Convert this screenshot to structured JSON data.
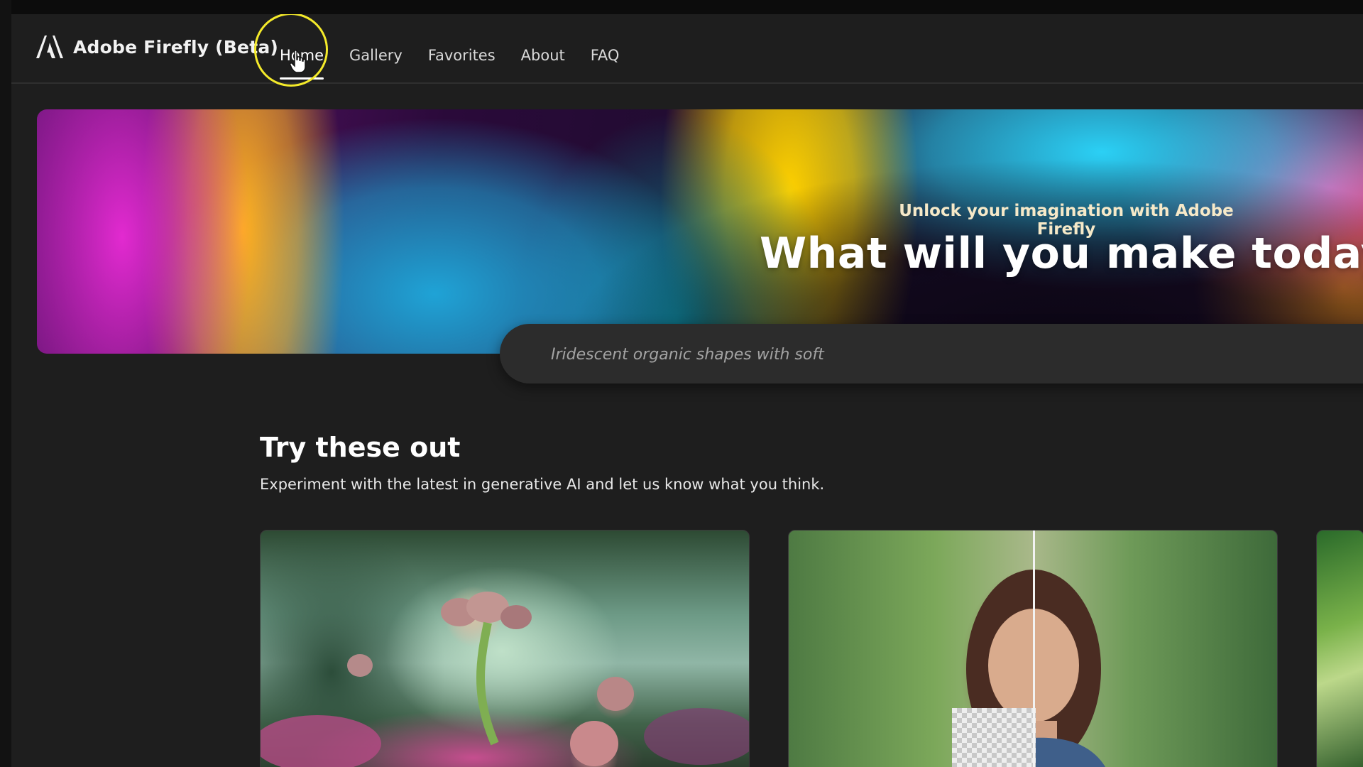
{
  "app": {
    "brand_name": "Adobe Firefly (Beta)",
    "logo_icon": "adobe-logo-icon"
  },
  "nav": {
    "items": [
      {
        "label": "Home",
        "active": true
      },
      {
        "label": "Gallery",
        "active": false
      },
      {
        "label": "Favorites",
        "active": false
      },
      {
        "label": "About",
        "active": false
      },
      {
        "label": "FAQ",
        "active": false
      }
    ]
  },
  "hero": {
    "eyebrow": "Unlock your imagination with Adobe Firefly",
    "title": "What will you make today?",
    "prompt_placeholder": "Iridescent organic shapes with soft"
  },
  "section": {
    "title": "Try these out",
    "subtitle": "Experiment with the latest in generative AI and let us know what you think."
  },
  "cards": [
    {
      "name": "text-to-image-card",
      "theme": "fantasy-garden"
    },
    {
      "name": "generative-fill-card",
      "theme": "portrait-background-removal"
    },
    {
      "name": "partial-card",
      "theme": "leaves"
    }
  ],
  "colors": {
    "background": "#1e1e1e",
    "highlight_ring": "#f4ea2a",
    "prompt_bar": "#2c2c2c"
  }
}
